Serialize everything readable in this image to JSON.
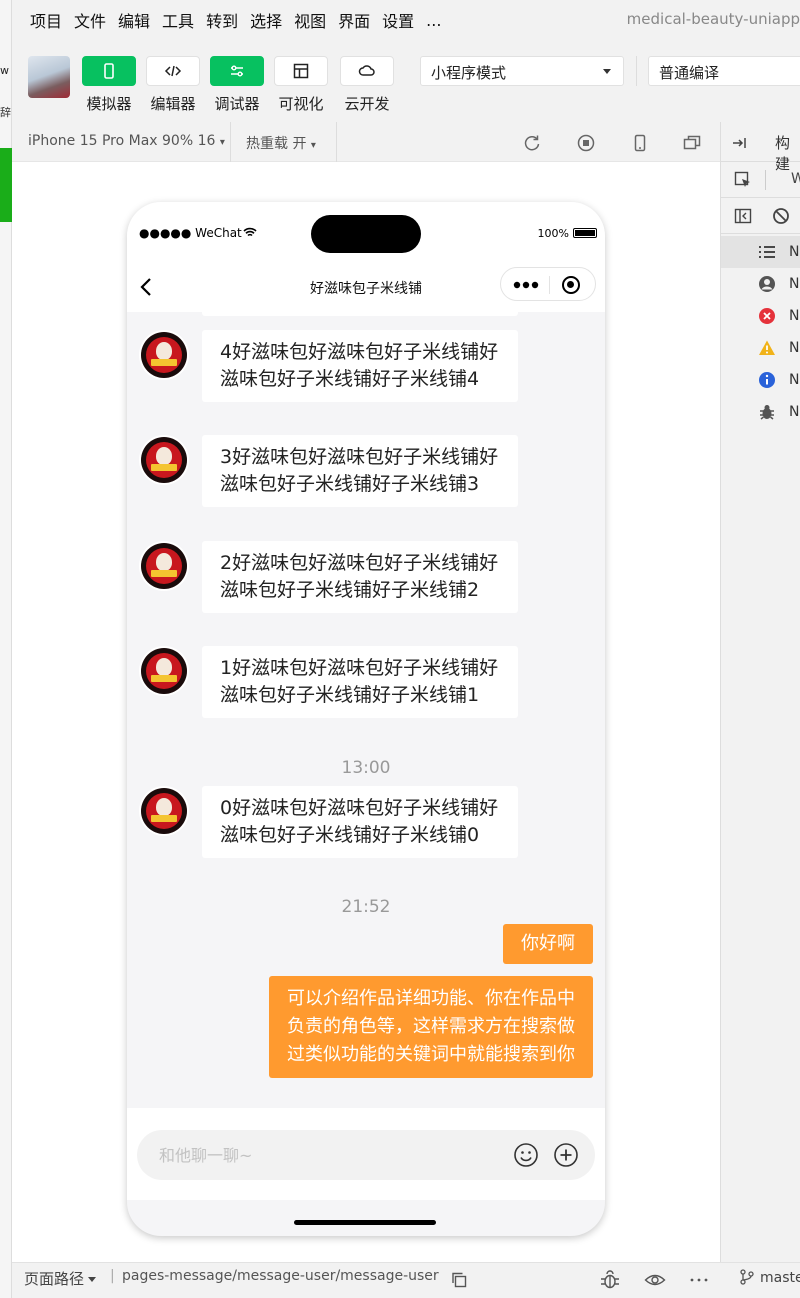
{
  "menu": {
    "items": [
      "项目",
      "文件",
      "编辑",
      "工具",
      "转到",
      "选择",
      "视图",
      "界面",
      "设置",
      "..."
    ],
    "app_title": "medical-beauty-uniapp"
  },
  "peek": {
    "chip": "w",
    "chip2": "辞"
  },
  "toolbar": {
    "buttons": [
      {
        "label": "模拟器",
        "icon": "phone-icon",
        "active": true
      },
      {
        "label": "编辑器",
        "icon": "code-icon",
        "active": false
      },
      {
        "label": "调试器",
        "icon": "sliders-icon",
        "active": true
      },
      {
        "label": "可视化",
        "icon": "layout-icon",
        "active": false
      },
      {
        "label": "云开发",
        "icon": "cloud-icon",
        "active": false
      }
    ],
    "mode_select": "小程序模式",
    "compile_select": "普通编译"
  },
  "simbar": {
    "device": "iPhone 15 Pro Max 90% 16",
    "hot_reload": "热重载 开"
  },
  "right_panel": {
    "header": "构建",
    "sub": "W",
    "rows": [
      {
        "icon": "list-icon",
        "label": "N"
      },
      {
        "icon": "user-circle-icon",
        "label": "N"
      },
      {
        "icon": "error-icon",
        "label": "N"
      },
      {
        "icon": "warning-icon",
        "label": "N"
      },
      {
        "icon": "info-icon",
        "label": "N"
      },
      {
        "icon": "bug-icon",
        "label": "N"
      }
    ]
  },
  "phone": {
    "carrier": "●●●●● WeChat",
    "battery": "100%",
    "nav_title": "好滋味包子米线铺",
    "messages": [
      {
        "text": "4好滋味包好滋味包好子米线铺好滋味包好子米线铺好子米线铺4"
      },
      {
        "text": "3好滋味包好滋味包好子米线铺好滋味包好子米线铺好子米线铺3"
      },
      {
        "text": "2好滋味包好滋味包好子米线铺好滋味包好子米线铺好子米线铺2"
      },
      {
        "text": "1好滋味包好滋味包好子米线铺好滋味包好子米线铺好子米线铺1"
      },
      {
        "text": "0好滋味包好滋味包好子米线铺好滋味包好子米线铺好子米线铺0"
      }
    ],
    "timestamps": [
      "13:00",
      "21:52"
    ],
    "my_messages": [
      "你好啊",
      "可以介绍作品详细功能、你在作品中负责的角色等，这样需求方在搜索做过类似功能的关键词中就能搜索到你"
    ],
    "input_placeholder": "和他聊一聊~"
  },
  "bottom": {
    "path_label": "页面路径",
    "route": "pages-message/message-user/message-user",
    "branch": "maste"
  },
  "colors": {
    "accent_green": "#07c160",
    "bubble_orange": "#ff9a2f"
  }
}
